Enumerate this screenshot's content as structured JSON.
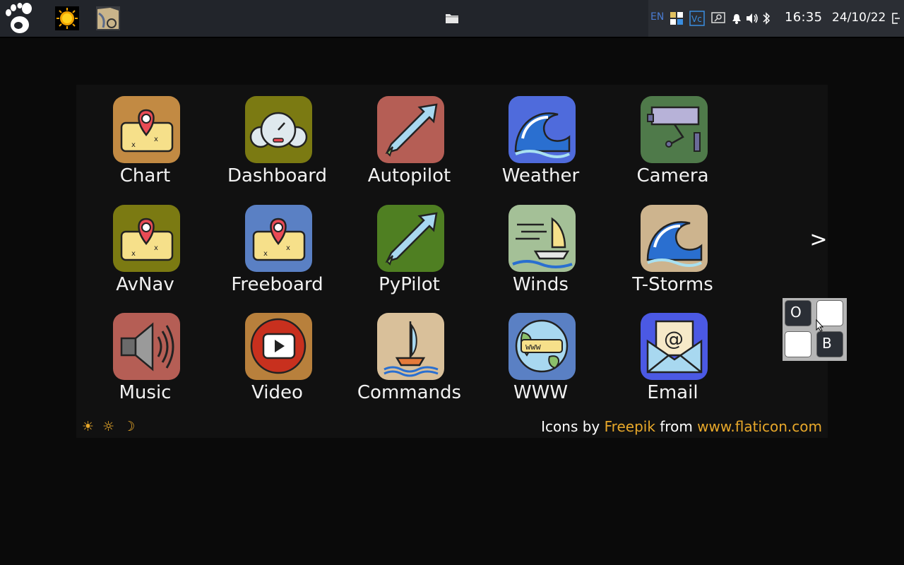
{
  "topbar": {
    "tray": {
      "language": "EN",
      "clock": "16:35",
      "date": "24/10/22"
    }
  },
  "launcher": {
    "tiles": [
      {
        "label": "Chart",
        "bg": "#c28a43",
        "icon": "treasure-map-icon"
      },
      {
        "label": "Dashboard",
        "bg": "#7b7a12",
        "icon": "gauges-icon"
      },
      {
        "label": "Autopilot",
        "bg": "#b55e55",
        "icon": "arrow-icon"
      },
      {
        "label": "Weather",
        "bg": "#4f6bdc",
        "icon": "wave-icon"
      },
      {
        "label": "Camera",
        "bg": "#4f7a4a",
        "icon": "security-camera-icon"
      },
      {
        "label": "AvNav",
        "bg": "#7b7a12",
        "icon": "treasure-map-icon"
      },
      {
        "label": "Freeboard",
        "bg": "#5a80c4",
        "icon": "treasure-map-icon"
      },
      {
        "label": "PyPilot",
        "bg": "#4f7f22",
        "icon": "arrow-icon"
      },
      {
        "label": "Winds",
        "bg": "#a4c097",
        "icon": "sailboat-wind-icon"
      },
      {
        "label": "T-Storms",
        "bg": "#cdb48e",
        "icon": "wave-icon"
      },
      {
        "label": "Music",
        "bg": "#b55e55",
        "icon": "speaker-icon"
      },
      {
        "label": "Video",
        "bg": "#b8803c",
        "icon": "play-button-icon"
      },
      {
        "label": "Commands",
        "bg": "#d9c09a",
        "icon": "sailboat-icon"
      },
      {
        "label": "WWW",
        "bg": "#5a80c4",
        "icon": "globe-icon"
      },
      {
        "label": "Email",
        "bg": "#4b59e4",
        "icon": "email-icon"
      }
    ],
    "next_label": ">",
    "mode_icons": [
      "☀",
      "☼",
      "☽"
    ],
    "credits": {
      "prefix": "Icons by",
      "author": "Freepik",
      "middle": "from",
      "site": "www.flaticon.com"
    }
  },
  "widget": {
    "top_left": "O",
    "bottom_right": "B"
  }
}
